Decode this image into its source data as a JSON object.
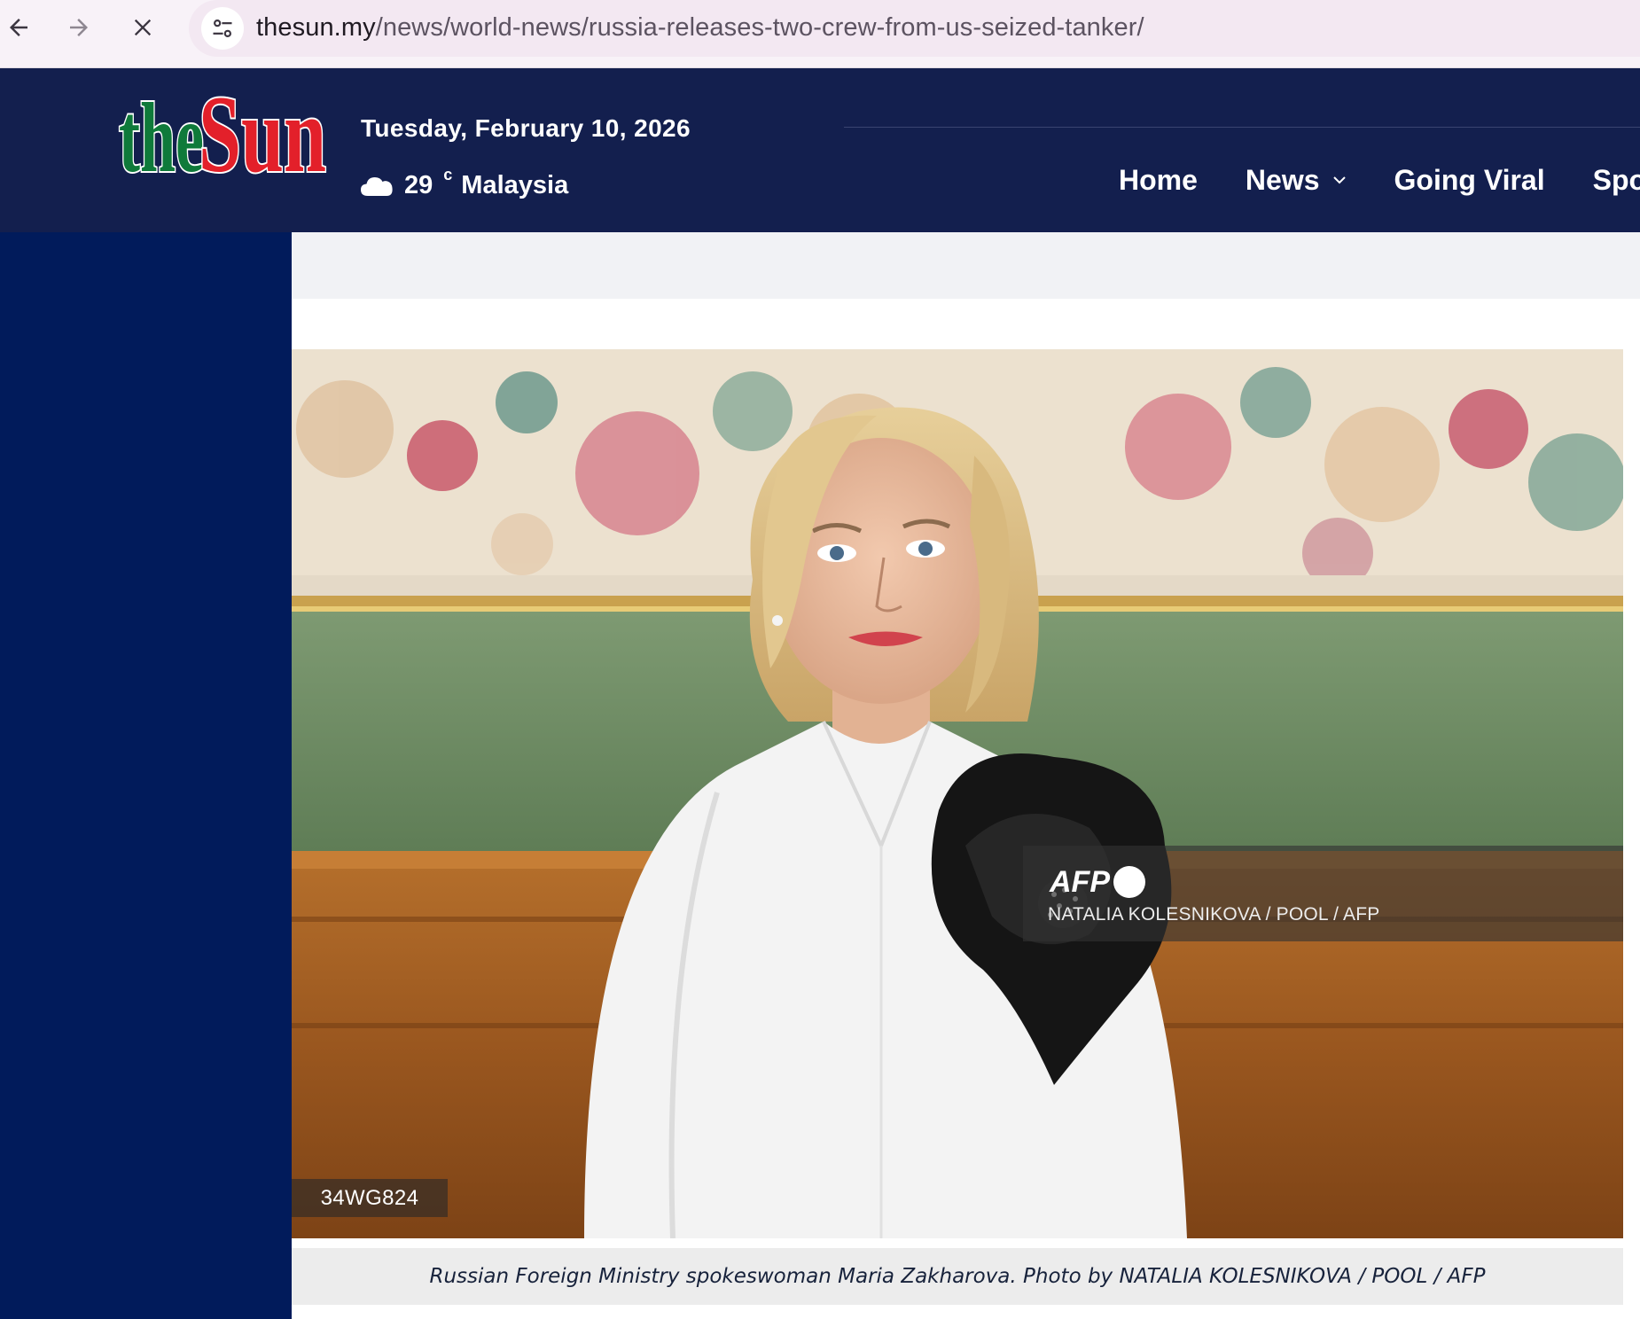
{
  "browser": {
    "url_host": "thesun.my",
    "url_path": "/news/world-news/russia-releases-two-crew-from-us-seized-tanker/",
    "back_icon": "back-arrow-icon",
    "forward_icon": "forward-arrow-icon",
    "stop_icon": "close-icon",
    "site_info_icon": "tune-icon"
  },
  "header": {
    "logo_text": "theSun",
    "date": "Tuesday, February 10, 2026",
    "weather": {
      "icon": "cloud-icon",
      "temperature": "29",
      "unit": "c",
      "location": "Malaysia"
    },
    "nav": [
      {
        "label": "Home"
      },
      {
        "label": "News",
        "has_dropdown": true
      },
      {
        "label": "Going Viral"
      },
      {
        "label": "Spo"
      }
    ],
    "colors": {
      "background": "#131f4e",
      "logo_green": "#0f7a3a",
      "logo_red": "#e3202a"
    }
  },
  "article": {
    "photo": {
      "watermark_brand": "AFP",
      "watermark_credit": "NATALIA KOLESNIKOVA / POOL / AFP",
      "photo_id": "34WG824"
    },
    "caption": "Russian Foreign Ministry spokeswoman Maria Zakharova. Photo by NATALIA KOLESNIKOVA / POOL / AFP"
  }
}
